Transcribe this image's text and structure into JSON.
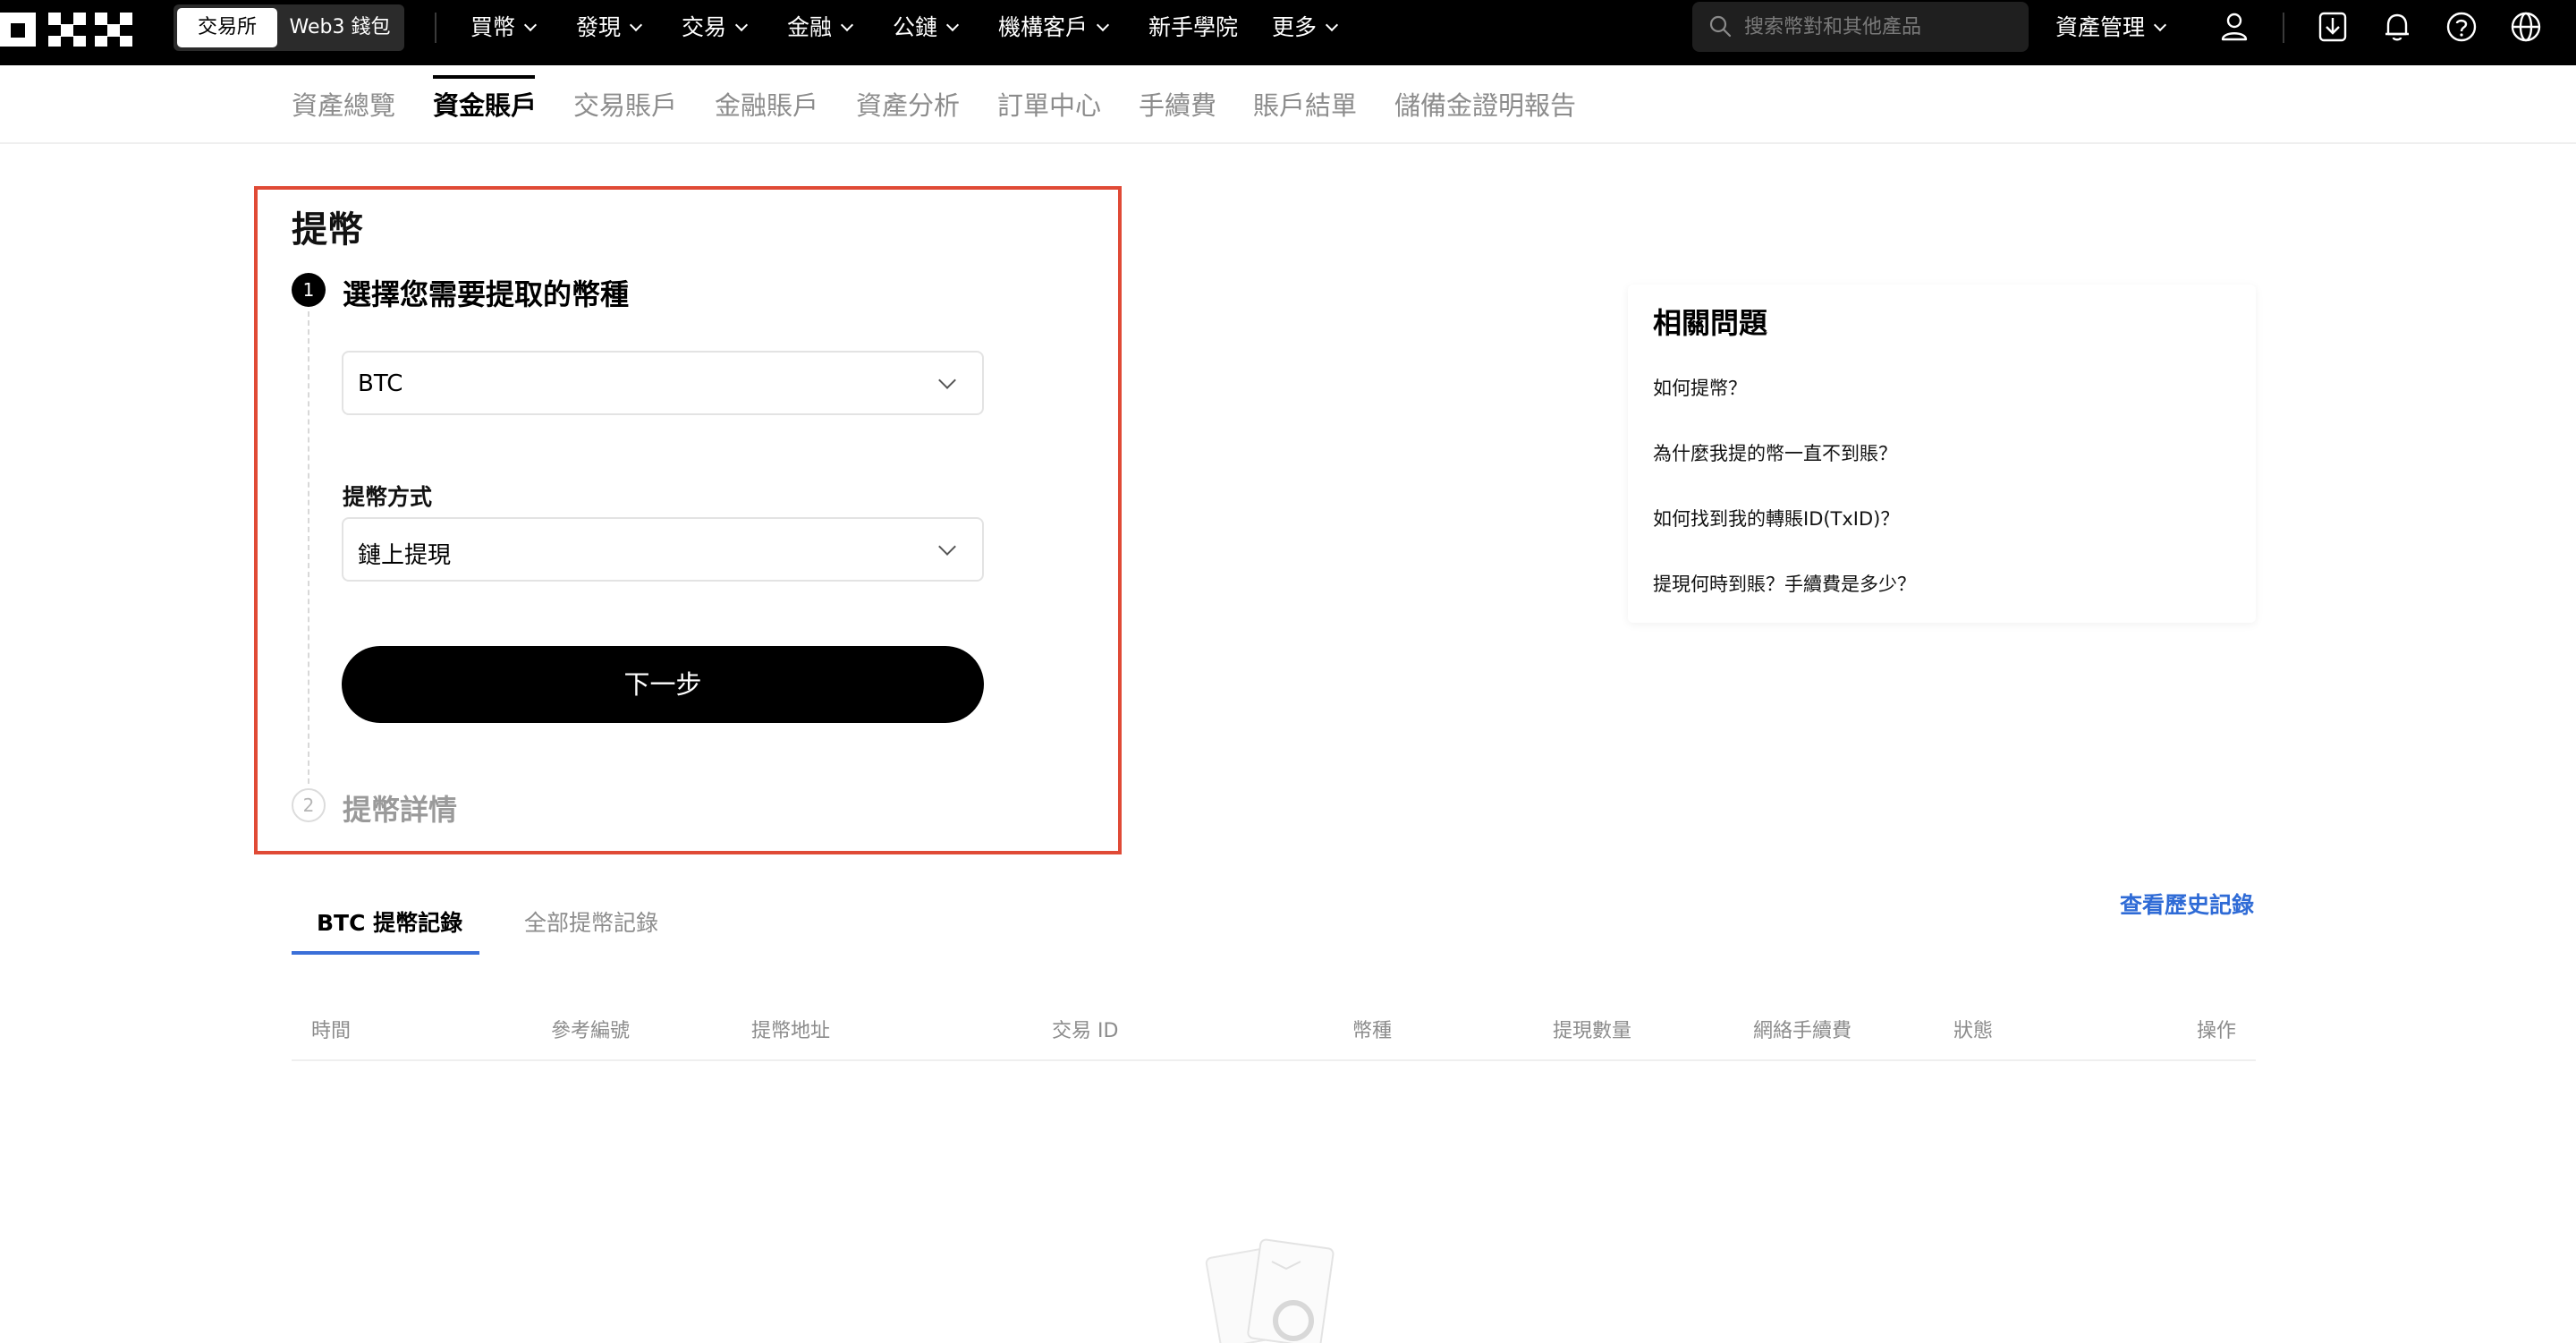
{
  "brand": {
    "logo_name": "OKX"
  },
  "segment": {
    "active": "交易所",
    "inactive": "Web3 錢包"
  },
  "nav": {
    "items": [
      {
        "label": "買幣",
        "has_dropdown": true
      },
      {
        "label": "發現",
        "has_dropdown": true
      },
      {
        "label": "交易",
        "has_dropdown": true
      },
      {
        "label": "金融",
        "has_dropdown": true
      },
      {
        "label": "公鏈",
        "has_dropdown": true
      },
      {
        "label": "機構客戶",
        "has_dropdown": true
      },
      {
        "label": "新手學院",
        "has_dropdown": false
      },
      {
        "label": "更多",
        "has_dropdown": true
      }
    ],
    "search_placeholder": "搜索幣對和其他產品",
    "asset_management": "資產管理",
    "icons": [
      "user-icon",
      "download-icon",
      "bell-icon",
      "help-icon",
      "globe-icon"
    ]
  },
  "subnav": {
    "tabs": [
      "資產總覽",
      "資金賬戶",
      "交易賬戶",
      "金融賬戶",
      "資產分析",
      "訂單中心",
      "手續費",
      "賬戶結單",
      "儲備金證明報告"
    ],
    "active_index": 1
  },
  "withdraw": {
    "title": "提幣",
    "step1": {
      "number": "1",
      "title": "選擇您需要提取的幣種"
    },
    "coin_select": {
      "value": "BTC"
    },
    "method": {
      "label": "提幣方式",
      "value": "鏈上提現"
    },
    "next_button": "下一步",
    "step2": {
      "number": "2",
      "title": "提幣詳情"
    }
  },
  "faq": {
    "title": "相關問題",
    "links": [
      "如何提幣？",
      "為什麼我提的幣一直不到賬？",
      "如何找到我的轉賬ID(TxID)？",
      "提現何時到賬？手續費是多少？"
    ]
  },
  "records": {
    "tabs": [
      "BTC 提幣記錄",
      "全部提幣記錄"
    ],
    "history_link": "查看歷史記錄",
    "columns": [
      "時間",
      "參考編號",
      "提幣地址",
      "交易 ID",
      "幣種",
      "提現數量",
      "網絡手續費",
      "狀態",
      "操作"
    ]
  },
  "colors": {
    "accent_red_frame": "#e04a36",
    "link_blue": "#2f6bd6",
    "topbar_bg": "#000000"
  }
}
